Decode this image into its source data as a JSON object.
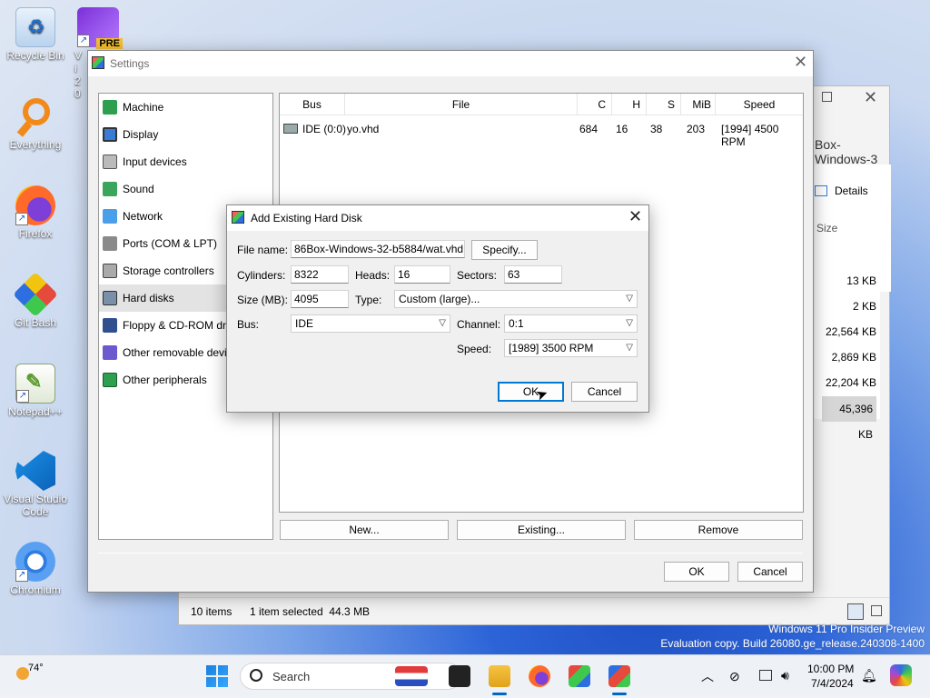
{
  "desktop": {
    "icons": [
      {
        "label": "Recycle Bin"
      },
      {
        "label": "Everything"
      },
      {
        "label": "Firefox"
      },
      {
        "label": "Git Bash"
      },
      {
        "label": "Notepad++"
      },
      {
        "label": "Visual Studio Code"
      },
      {
        "label": "Chromium"
      }
    ],
    "vs_badge": "PRE",
    "vs_label_partial": "Vi 20",
    "watermark_line1": "Windows 11 Pro Insider Preview",
    "watermark_line2": "Evaluation copy. Build 26080.ge_release.240308-1400"
  },
  "explorer": {
    "title_partial": "Box-Windows-3",
    "details_label": "Details",
    "size_header": "Size",
    "sizes": [
      "13 KB",
      "2 KB",
      "22,564 KB",
      "2,869 KB",
      "22,204 KB",
      "45,396 KB"
    ],
    "status_items": "10 items",
    "status_selected": "1 item selected  44.3 MB"
  },
  "settings": {
    "title": "Settings",
    "sidebar": [
      {
        "label": "Machine"
      },
      {
        "label": "Display"
      },
      {
        "label": "Input devices"
      },
      {
        "label": "Sound"
      },
      {
        "label": "Network"
      },
      {
        "label": "Ports (COM & LPT)"
      },
      {
        "label": "Storage controllers"
      },
      {
        "label": "Hard disks"
      },
      {
        "label": "Floppy & CD-ROM drives"
      },
      {
        "label": "Other removable devices"
      },
      {
        "label": "Other peripherals"
      }
    ],
    "columns": {
      "bus": "Bus",
      "file": "File",
      "c": "C",
      "h": "H",
      "s": "S",
      "mib": "MiB",
      "speed": "Speed"
    },
    "disks": [
      {
        "bus": "IDE (0:0)",
        "file": "yo.vhd",
        "c": "684",
        "h": "16",
        "s": "38",
        "mib": "203",
        "speed": "[1994] 4500 RPM"
      }
    ],
    "buttons": {
      "new": "New...",
      "existing": "Existing...",
      "remove": "Remove",
      "ok": "OK",
      "cancel": "Cancel"
    }
  },
  "dialog": {
    "title": "Add Existing Hard Disk",
    "file_name_label": "File name:",
    "file_name_value": "86Box-Windows-32-b5884/wat.vhd",
    "specify": "Specify...",
    "cylinders_label": "Cylinders:",
    "cylinders_value": "8322",
    "heads_label": "Heads:",
    "heads_value": "16",
    "sectors_label": "Sectors:",
    "sectors_value": "63",
    "size_label": "Size (MB):",
    "size_value": "4095",
    "type_label": "Type:",
    "type_value": "Custom (large)...",
    "bus_label": "Bus:",
    "bus_value": "IDE",
    "channel_label": "Channel:",
    "channel_value": "0:1",
    "speed_label": "Speed:",
    "speed_value": "[1989] 3500 RPM",
    "ok": "OK",
    "cancel": "Cancel"
  },
  "taskbar": {
    "weather": "74°",
    "search_placeholder": "Search",
    "time": "10:00 PM",
    "date": "7/4/2024"
  }
}
